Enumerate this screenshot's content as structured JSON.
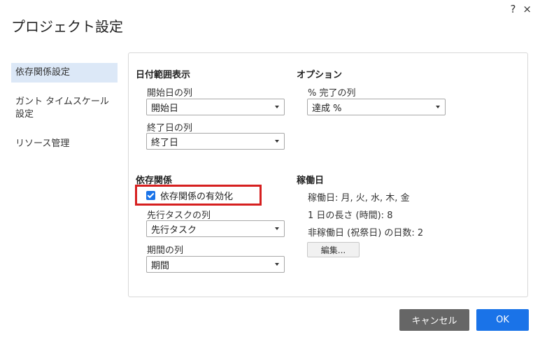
{
  "dialog": {
    "title": "プロジェクト設定",
    "help_icon": "?",
    "close_icon": "×"
  },
  "sidebar": {
    "items": [
      {
        "label": "依存関係設定",
        "active": true
      },
      {
        "label": "ガント タイムスケール 設定",
        "active": false
      },
      {
        "label": "リソース管理",
        "active": false
      }
    ]
  },
  "date_range": {
    "title": "日付範囲表示",
    "start_label": "開始日の列",
    "start_value": "開始日",
    "end_label": "終了日の列",
    "end_value": "終了日"
  },
  "options": {
    "title": "オプション",
    "percent_label": "% 完了の列",
    "percent_value": "達成 %"
  },
  "dependencies": {
    "title": "依存関係",
    "enable_label": "依存関係の有効化",
    "enable_checked": true,
    "predecessor_label": "先行タスクの列",
    "predecessor_value": "先行タスク",
    "duration_label": "期間の列",
    "duration_value": "期間"
  },
  "working_days": {
    "title": "稼働日",
    "days_text": "稼働日: 月, 火, 水, 木, 金",
    "day_length_text": "1 日の長さ (時間): 8",
    "holidays_text": "非稼働日 (祝祭日) の日数: 2",
    "edit_label": "編集..."
  },
  "footer": {
    "cancel_label": "キャンセル",
    "ok_label": "OK"
  },
  "colors": {
    "primary": "#1a73e8",
    "highlight_border": "#d61f1f",
    "cancel_bg": "#666666",
    "sidebar_active": "#dce8f7"
  }
}
